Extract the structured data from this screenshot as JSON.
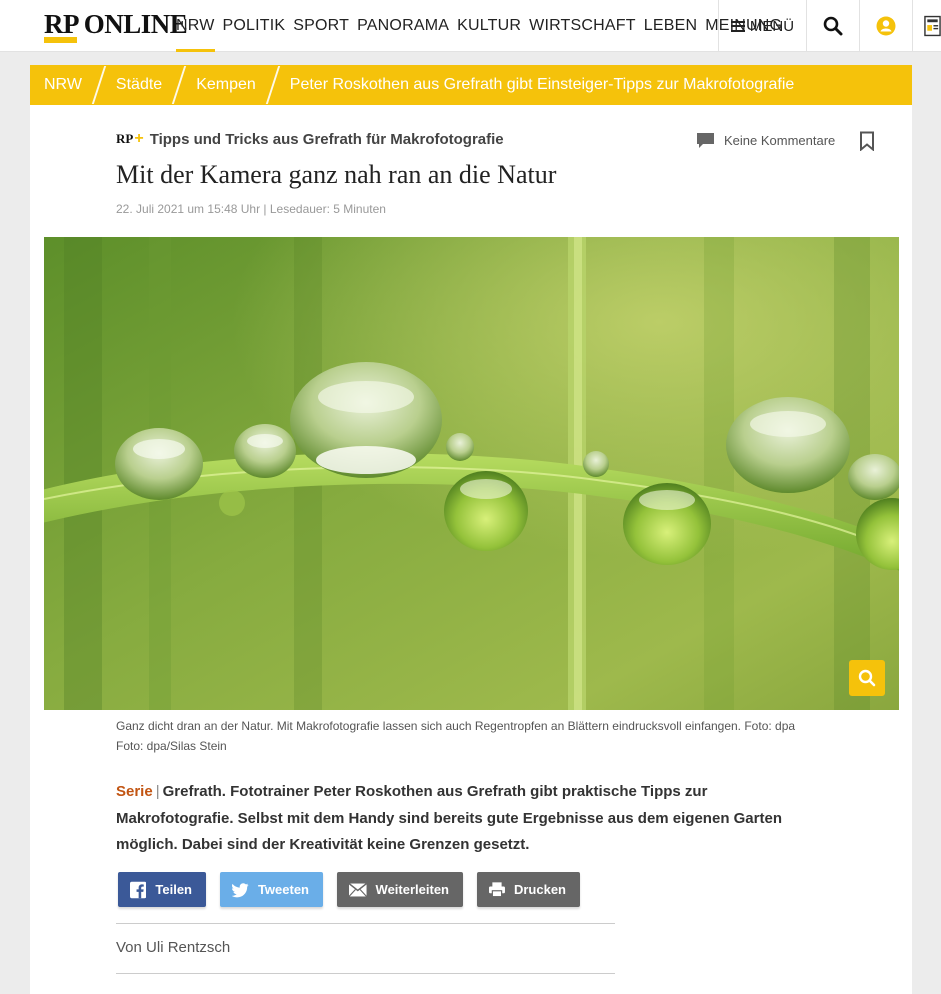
{
  "header": {
    "logo_text": "RP ONLINE",
    "nav": [
      "NRW",
      "POLITIK",
      "SPORT",
      "PANORAMA",
      "KULTUR",
      "WIRTSCHAFT",
      "LEBEN",
      "MEINUNG"
    ],
    "menu_label": "MENÜ",
    "accent_color": "#f5c20b"
  },
  "breadcrumb": [
    "NRW",
    "Städte",
    "Kempen",
    "Peter Roskothen aus Grefrath gibt Einsteiger-Tipps zur Makrofotografie"
  ],
  "article": {
    "badge": "RP",
    "kicker": "Tipps und Tricks aus Grefrath für Makrofotografie",
    "comments_label": "Keine Kommentare",
    "headline": "Mit der Kamera ganz nah ran an die Natur",
    "dateline": "22. Juli 2021 um 15:48 Uhr | Lesedauer: 5 Minuten",
    "caption": "Ganz dicht dran an der Natur. Mit Makrofotografie lassen sich auch Regentropfen an Blättern eindrucksvoll einfangen. Foto: dpa Foto: dpa/Silas Stein",
    "lead_series": "Serie",
    "lead_text": "Grefrath.  Fototrainer Peter Roskothen aus Grefrath gibt praktische Tipps zur Makrofotografie. Selbst mit dem Handy sind bereits gute Ergebnisse aus dem eigenen Garten möglich. Dabei sind der Kreativität keine Grenzen gesetzt.",
    "share": {
      "facebook": "Teilen",
      "twitter": "Tweeten",
      "email": "Weiterleiten",
      "print": "Drucken"
    },
    "byline": "Von Uli Rentzsch"
  },
  "icons": {
    "search": "search-icon",
    "user": "user-icon",
    "newspaper": "newspaper-icon",
    "comment": "comment-icon",
    "bookmark": "bookmark-icon",
    "zoom": "zoom-icon"
  }
}
